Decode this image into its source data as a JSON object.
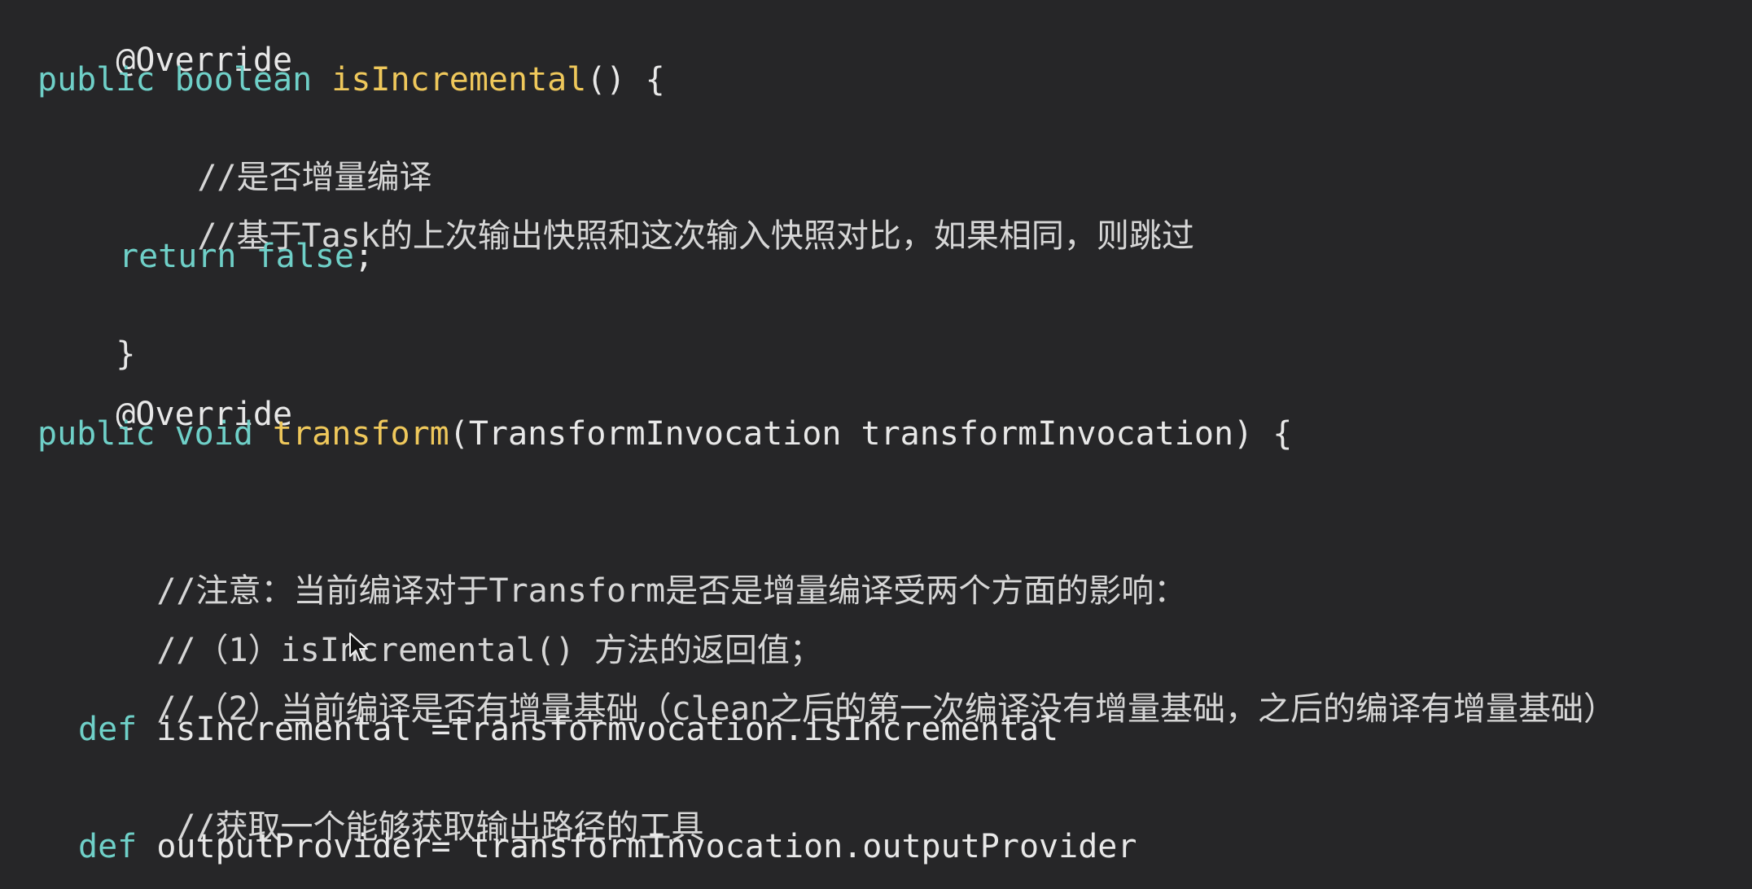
{
  "colors": {
    "background": "#262628",
    "keyword": "#6fd0c8",
    "function": "#efc85b",
    "plain": "#e8e8e8",
    "comment": "#d6d6d6"
  },
  "code": {
    "line1": {
      "annotation": "@Override"
    },
    "line2": {
      "kw1": "public",
      "kw2": "boolean",
      "fn": "isIncremental",
      "rest": "() {"
    },
    "line3": {
      "comment": "//是否增量编译"
    },
    "line4": {
      "comment": "//基于Task的上次输出快照和这次输入快照对比，如果相同，则跳过"
    },
    "line5": {
      "kw1": "return",
      "kw2": "false",
      "rest": ";"
    },
    "line6": {
      "brace": "}"
    },
    "line7": {
      "annotation": "@Override"
    },
    "line8": {
      "kw1": "public",
      "kw2": "void",
      "fn": "transform",
      "rest": "(TransformInvocation transformInvocation) {"
    },
    "line10": {
      "comment": "//注意：当前编译对于Transform是否是增量编译受两个方面的影响："
    },
    "line11": {
      "comment": "//（1）isIncremental() 方法的返回值；"
    },
    "line12": {
      "comment": "//（2）当前编译是否有增量基础（clean之后的第一次编译没有增量基础，之后的编译有增量基础）"
    },
    "line13": {
      "kw": "def",
      "rest": " isIncremental =transformvocation.isIncremental"
    },
    "line14": {
      "comment": "//获取一个能够获取输出路径的工具"
    },
    "line15": {
      "kw": "def",
      "rest": " outputProvider= transformInvocation.outputProvider"
    }
  },
  "icons": {
    "cursor": "mouse-pointer-icon"
  }
}
